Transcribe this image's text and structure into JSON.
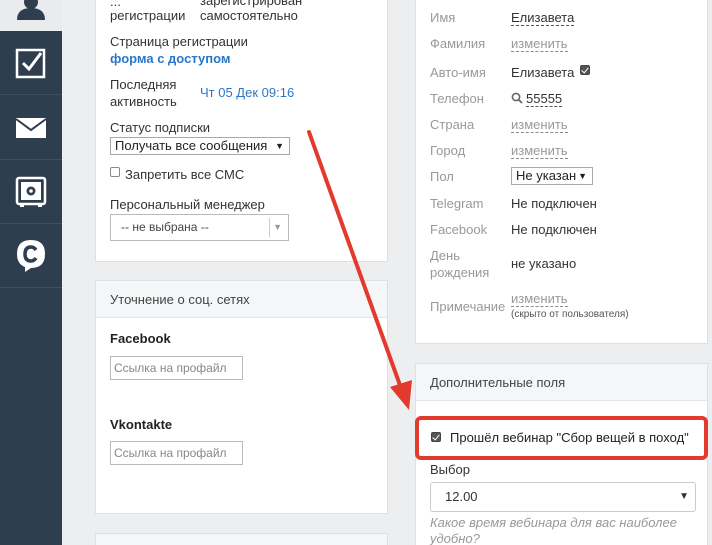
{
  "sidebar": {
    "items": [
      {
        "icon": "user-icon"
      },
      {
        "icon": "checkbox-icon"
      },
      {
        "icon": "mail-icon"
      },
      {
        "icon": "safe-icon"
      },
      {
        "icon": "chat-c-icon"
      }
    ]
  },
  "left_panel": {
    "reg_label_1": "...",
    "reg_label_2": "регистрации",
    "reg_value_1": "зарегистрирован",
    "reg_value_2": "самостоятельно",
    "reg_page_label": "Страница регистрации",
    "reg_page_value": "форма с доступом",
    "last_activity_label_1": "Последняя",
    "last_activity_label_2": "активность",
    "last_activity_value": "Чт 05 Дек 09:16",
    "subscription_label": "Статус подписки",
    "subscription_value": "Получать все сообщения",
    "sms_label": "Запретить все СМС",
    "manager_label": "Персональный менеджер",
    "manager_value": "-- не выбрана --"
  },
  "social_panel": {
    "title": "Уточнение о соц. сетях",
    "facebook_label": "Facebook",
    "facebook_placeholder": "Ссылка на профайл",
    "vk_label": "Vkontakte",
    "vk_placeholder": "Ссылка на профайл"
  },
  "right_panel": {
    "name_label": "Имя",
    "name_value": "Елизавета",
    "surname_label": "Фамилия",
    "surname_value": "изменить",
    "autoname_label": "Авто-имя",
    "autoname_value": "Елизавета",
    "phone_label": "Телефон",
    "phone_value": "55555",
    "country_label": "Страна",
    "country_value": "изменить",
    "city_label": "Город",
    "city_value": "изменить",
    "gender_label": "Пол",
    "gender_value": "Не указан",
    "telegram_label": "Telegram",
    "telegram_value": "Не подключен",
    "facebook_label": "Facebook",
    "facebook_value": "Не подключен",
    "birthday_label_1": "День",
    "birthday_label_2": "рождения",
    "birthday_value": "не указано",
    "note_label": "Примечание",
    "note_value": "изменить",
    "note_hint": "(скрыто от пользователя)"
  },
  "extra_panel": {
    "title": "Дополнительные поля",
    "webinar_checkbox_label": "Прошёл вебинар \"Сбор вещей в поход\"",
    "choice_label": "Выбор",
    "choice_value": "12.00",
    "choice_hint_1": "Какое время вебинара для вас наиболее",
    "choice_hint_2": "удобно?"
  },
  "colors": {
    "sidebar": "#2e3e4e",
    "accent_link": "#2a77c9",
    "annotation_red": "#e23b2e"
  }
}
